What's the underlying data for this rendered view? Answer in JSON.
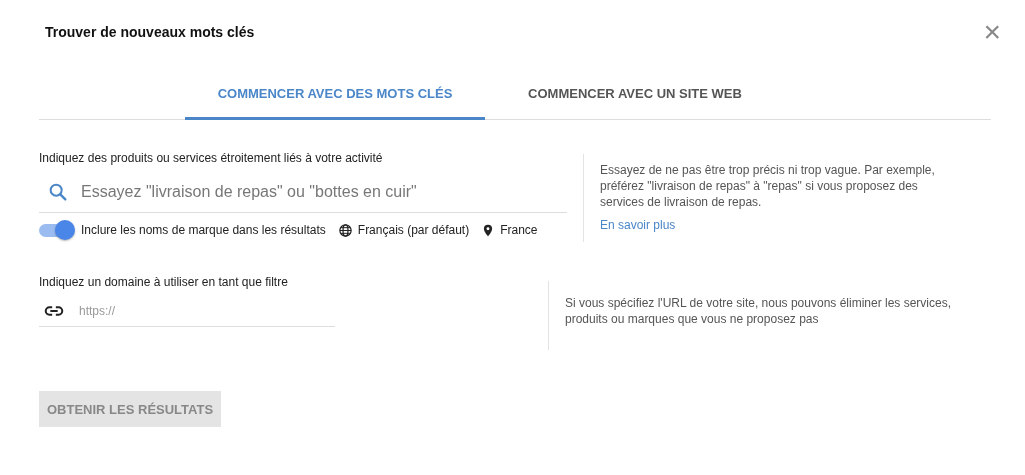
{
  "dialog": {
    "title": "Trouver de nouveaux mots clés",
    "close": "×"
  },
  "tabs": [
    {
      "label": "COMMENCER AVEC DES MOTS CLÉS",
      "selected": true
    },
    {
      "label": "COMMENCER AVEC UN SITE WEB",
      "selected": false
    }
  ],
  "keywords": {
    "label": "Indiquez des produits ou services étroitement liés à votre activité",
    "placeholder": "Essayez \"livraison de repas\" ou \"bottes en cuir\"",
    "brand_toggle": {
      "label": "Inclure les noms de marque dans les résultats",
      "on": true
    },
    "language": "Français (par défaut)",
    "location": "France",
    "help": "Essayez de ne pas être trop précis ni trop vague. Par exemple, préférez \"livraison de repas\" à \"repas\" si vous proposez des services de livraison de repas.",
    "help_link": "En savoir plus"
  },
  "domain": {
    "label": "Indiquez un domaine à utiliser en tant que filtre",
    "placeholder": "https://",
    "help": "Si vous spécifiez l'URL de votre site, nous pouvons éliminer les services, produits ou marques que vous ne proposez pas"
  },
  "submit": {
    "label": "OBTENIR LES RÉSULTATS",
    "disabled": true
  }
}
